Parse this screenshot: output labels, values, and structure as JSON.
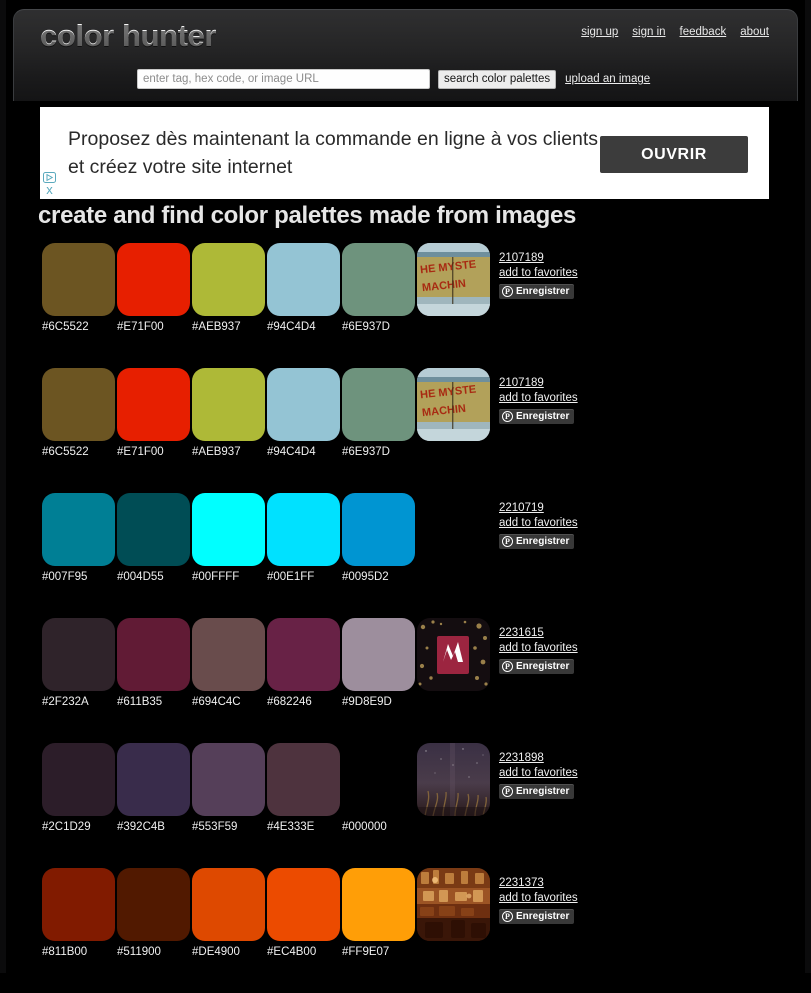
{
  "header": {
    "logo": "color hunter",
    "nav": [
      {
        "label": "sign up",
        "name": "nav-sign-up"
      },
      {
        "label": "sign in",
        "name": "nav-sign-in"
      },
      {
        "label": "feedback",
        "name": "nav-feedback"
      },
      {
        "label": "about",
        "name": "nav-about"
      }
    ],
    "search": {
      "placeholder": "enter tag, hex code, or image URL",
      "value": "",
      "button_label": "search color palettes",
      "upload_label": "upload an image"
    }
  },
  "ad": {
    "text": "Proposez dès maintenant la commande en ligne à vos clients et créez votre site internet",
    "cta_label": "OUVRIR",
    "adchoices_icon": "adchoices-triangle-icon",
    "close_icon": "close-x-icon",
    "close_label": "x"
  },
  "tagline": "create and find color palettes made from images",
  "pin_button": {
    "label": "Enregistrer",
    "glyph": "P",
    "icon": "pinterest-icon"
  },
  "favorites_label": "add to favorites",
  "palettes": [
    {
      "id": "2107189",
      "colors": [
        "#6C5522",
        "#E71F00",
        "#AEB937",
        "#94C4D4",
        "#6E937D"
      ],
      "labels": [
        "#6C5522",
        "#E71F00",
        "#AEB937",
        "#94C4D4",
        "#6E937D"
      ],
      "thumbnail": "mystery-machine-van-thumbnail",
      "has_thumbnail": true
    },
    {
      "id": "2107189",
      "colors": [
        "#6C5522",
        "#E71F00",
        "#AEB937",
        "#94C4D4",
        "#6E937D"
      ],
      "labels": [
        "#6C5522",
        "#E71F00",
        "#AEB937",
        "#94C4D4",
        "#6E937D"
      ],
      "thumbnail": "mystery-machine-van-thumbnail",
      "has_thumbnail": true
    },
    {
      "id": "2210719",
      "colors": [
        "#007F95",
        "#004D55",
        "#00FFFF",
        "#00E1FF",
        "#0095D2"
      ],
      "labels": [
        "#007F95",
        "#004D55",
        "#00FFFF",
        "#00E1FF",
        "#0095D2"
      ],
      "thumbnail": "",
      "has_thumbnail": false
    },
    {
      "id": "2231615",
      "colors": [
        "#2F232A",
        "#611B35",
        "#694C4C",
        "#682246",
        "#9D8E9D"
      ],
      "labels": [
        "#2F232A",
        "#611B35",
        "#694C4C",
        "#682246",
        "#9D8E9D"
      ],
      "thumbnail": "night-sign-lights-thumbnail",
      "has_thumbnail": true
    },
    {
      "id": "2231898",
      "colors": [
        "#2C1D29",
        "#392C4B",
        "#553F59",
        "#4E333E",
        "#000000"
      ],
      "labels": [
        "#2C1D29",
        "#392C4B",
        "#553F59",
        "#4E333E",
        "#000000"
      ],
      "thumbnail": "night-sky-grass-thumbnail",
      "has_thumbnail": true
    },
    {
      "id": "2231373",
      "colors": [
        "#811B00",
        "#511900",
        "#DE4900",
        "#EC4B00",
        "#FF9E07"
      ],
      "labels": [
        "#811B00",
        "#511900",
        "#DE4900",
        "#EC4B00",
        "#FF9E07"
      ],
      "thumbnail": "warm-interior-market-thumbnail",
      "has_thumbnail": true
    }
  ]
}
